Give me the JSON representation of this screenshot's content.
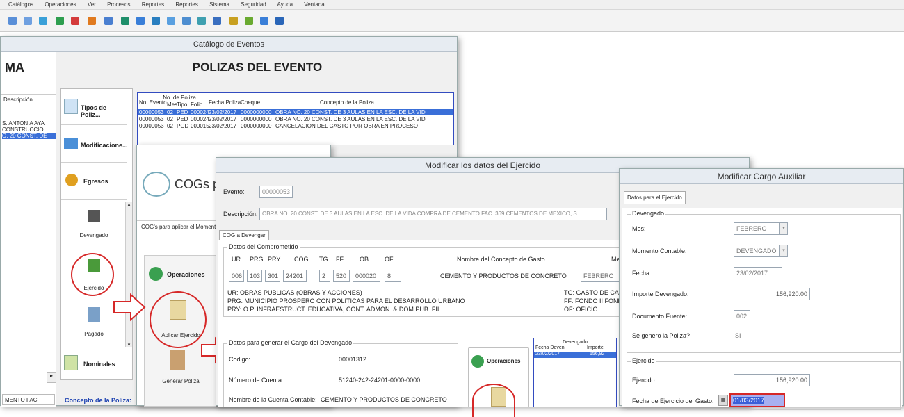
{
  "menubar": {
    "items": [
      "Catálogos",
      "Operaciones",
      "Ver",
      "Procesos",
      "Reportes",
      "Reportes",
      "Sistema",
      "Seguridad",
      "Ayuda",
      "Ventana"
    ]
  },
  "main_window": {
    "title": "Catálogo de Eventos",
    "left_header": "MA",
    "heading": "POLIZAS DEL EVENTO",
    "left_list": {
      "header": "Descripción",
      "items": [
        "S. ANTONIA AYA",
        "CONSTRUCCIO",
        "O. 20 CONST. DE"
      ],
      "footer": "MENTO FAC."
    },
    "sidebar": [
      {
        "label": "Tipos de Poliz..."
      },
      {
        "label": "Modificacione..."
      },
      {
        "label": "Egresos"
      },
      {
        "label": "Devengado"
      },
      {
        "label": "Ejercido"
      },
      {
        "label": "Pagado"
      },
      {
        "label": "Nominales"
      }
    ],
    "polizas_table": {
      "group_header": "No. de Poliza",
      "headers": [
        "No. Evento",
        "Mes",
        "Tipo",
        "Folio",
        "Fecha Poliza",
        "Cheque",
        "Concepto de la Poliza"
      ],
      "rows": [
        [
          "00000053",
          "02",
          "PED",
          "000024",
          "23/02/2017",
          "0000000000",
          "OBRA NO. 20 CONST. DE 3 AULAS EN LA ESC. DE LA VID"
        ],
        [
          "00000053",
          "02",
          "PED",
          "000024",
          "23/02/2017",
          "0000000000",
          "OBRA NO. 20 CONST. DE 3 AULAS EN LA ESC. DE LA VID"
        ],
        [
          "00000053",
          "02",
          "PGD",
          "000015",
          "23/02/2017",
          "0000000000",
          "CANCELACION DEL GASTO POR OBRA EN PROCESO"
        ]
      ]
    },
    "concepto_label": "Concepto de la Poliza:"
  },
  "cogs_window": {
    "title": "COGs p",
    "caption": "COG's para aplicar el Moment",
    "operaciones_label": "Operaciones",
    "aplicar_label": "Aplicar Ejercido",
    "generar_label": "Generar Poliza"
  },
  "modificar_ejercicio": {
    "title": "Modificar los datos del Ejercido",
    "evento_label": "Evento:",
    "evento_value": "00000053",
    "descripcion_label": "Descripción:",
    "descripcion_value": "OBRA NO. 20 CONST. DE 3 AULAS EN LA ESC. DE LA VIDA COMPRA DE CEMENTO FAC. 369 CEMENTOS DE MEXICO, S",
    "tab": "COG a Devengar",
    "comprometido_legend": "Datos del Comprometido",
    "cols": [
      "UR",
      "PRG",
      "PRY",
      "COG",
      "TG",
      "FF",
      "OB",
      "OF"
    ],
    "values": [
      "006",
      "103",
      "301",
      "24201",
      "2",
      "520",
      "000020",
      "8"
    ],
    "nombre_concepto_label": "Nombre del Concepto de Gasto",
    "nombre_concepto_value": "CEMENTO Y PRODUCTOS DE CONCRETO",
    "mes_label": "Me",
    "mes_value": "FEBRERO",
    "ur_desc": "UR:  OBRAS PUBLICAS (OBRAS Y ACCIONES)",
    "prg_desc": "PRG: MUNICIPIO PROSPERO CON POLITICAS PARA EL DESARROLLO URBANO",
    "pry_desc": "PRY: O.P. INFRAESTRUCT. EDUCATIVA, CONT. ADMON. & DOM.PUB. FII",
    "tg_desc": "TG:  GASTO DE CAPITA",
    "ff_desc": "FF:  FONDO II FONDO",
    "of_desc": "OF:  OFICIO",
    "cargo_legend": "Datos para generar el Cargo del Devengado",
    "codigo_label": "Codigo:",
    "codigo_value": "00001312",
    "cuenta_label": "Número de Cuenta:",
    "cuenta_value": "51240-242-24201-0000-0000",
    "nombre_cuenta_label": "Nombre de la Cuenta Contable:",
    "nombre_cuenta_value": "CEMENTO Y PRODUCTOS DE CONCRETO",
    "operaciones_label": "Operaciones",
    "devengado_header": "Devengado",
    "devengado_cols": [
      "Fecha Deven.",
      "Importe"
    ],
    "devengado_row": [
      "23/02/2017",
      "156,92"
    ]
  },
  "cargo_auxiliar": {
    "title": "Modificar Cargo Auxiliar",
    "tab": "Datos para el Ejercido",
    "devengado_legend": "Devengado",
    "mes_label": "Mes:",
    "mes_value": "FEBRERO",
    "momento_label": "Momento Contable:",
    "momento_value": "DEVENGADO",
    "fecha_label": "Fecha:",
    "fecha_value": "23/02/2017",
    "importe_label": "Importe Devengado:",
    "importe_value": "156,920.00",
    "documento_label": "Documento Fuente:",
    "documento_value": "002",
    "poliza_label": "Se genero la Poliza?",
    "poliza_value": "SI",
    "ejercido_legend": "Ejercido",
    "ejercido_label": "Ejercido:",
    "ejercido_value": "156,920.00",
    "fecha_ejercicio_label": "Fecha de Ejercicio del Gasto:",
    "fecha_ejercicio_value": "01/03/2017"
  }
}
